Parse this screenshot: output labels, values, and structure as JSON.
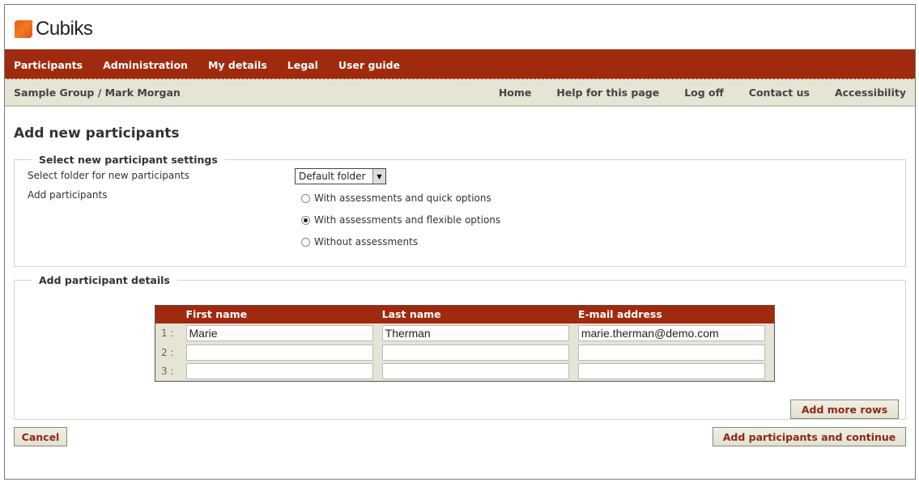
{
  "brand": {
    "name": "Cubiks"
  },
  "mainnav": [
    "Participants",
    "Administration",
    "My details",
    "Legal",
    "User guide"
  ],
  "subnav": {
    "crumb": "Sample Group / Mark Morgan",
    "links": [
      "Home",
      "Help for this page",
      "Log off",
      "Contact us",
      "Accessibility"
    ]
  },
  "page": {
    "title": "Add new participants"
  },
  "settings": {
    "legend": "Select new participant settings",
    "folder_label": "Select folder for new participants",
    "folder_value": "Default folder",
    "add_label": "Add participants",
    "options": [
      {
        "label": "With assessments and quick options",
        "checked": false
      },
      {
        "label": "With assessments and flexible options",
        "checked": true
      },
      {
        "label": "Without assessments",
        "checked": false
      }
    ]
  },
  "details": {
    "legend": "Add participant details",
    "columns": [
      "First name",
      "Last name",
      "E-mail address"
    ],
    "rows": [
      {
        "num": "1 :",
        "first": "Marie",
        "last": "Therman",
        "email": "marie.therman@demo.com"
      },
      {
        "num": "2 :",
        "first": "",
        "last": "",
        "email": ""
      },
      {
        "num": "3 :",
        "first": "",
        "last": "",
        "email": ""
      }
    ]
  },
  "buttons": {
    "add_rows": "Add more rows",
    "cancel": "Cancel",
    "continue": "Add participants and continue"
  },
  "colors": {
    "brand_red": "#a02a0e",
    "subnav_bg": "#e6e4d5",
    "logo_orange": "#f47a20"
  }
}
